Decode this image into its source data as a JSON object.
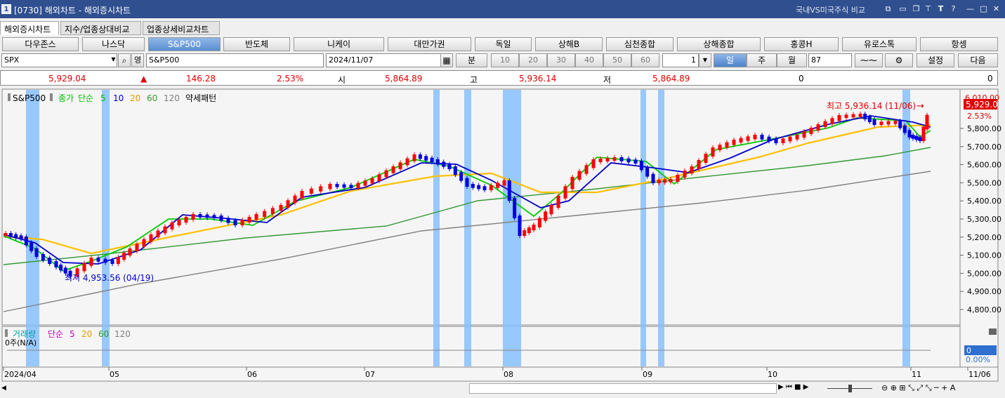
{
  "window": {
    "title": "[0730] 해외차트 - 해외증시차트",
    "badge": "1",
    "compare": "국내VS미국주식 비교",
    "tool_t": "T",
    "tool_q": "?",
    "tool_min": "—",
    "tool_max": "□",
    "tool_close": "✕"
  },
  "tabs": [
    "해외증시차트",
    "지수/업종상대비교",
    "업종상세비교차트"
  ],
  "markets": [
    "다우존스",
    "나스닥",
    "S&P500",
    "반도체",
    "니케이",
    "대만가권",
    "독일",
    "상해B",
    "심천종합",
    "상해종합",
    "홍콩H",
    "유로스톡",
    "항셍"
  ],
  "controls": {
    "symbol": "SPX",
    "kor_btn": "영",
    "name": "S&P500",
    "date": "2024/11/07",
    "minute": "분",
    "intervals": [
      "10",
      "20",
      "30",
      "40",
      "50",
      "60"
    ],
    "unit_count": "1",
    "periods": [
      "일",
      "주",
      "월"
    ],
    "count": "87",
    "settings": "설정",
    "next": "다음"
  },
  "quote": {
    "price": "5,929.04",
    "arrow": "▲",
    "change": "146.28",
    "pct": "2.53%",
    "open_lbl": "시",
    "open": "5,864.89",
    "high_lbl": "고",
    "high": "5,936.14",
    "low_lbl": "저",
    "low": "5,864.89",
    "vol1": "0",
    "vol2": "0"
  },
  "legend": {
    "name": "S&P500",
    "close": "종가",
    "simple": "단순",
    "ma": [
      "5",
      "10",
      "20",
      "60",
      "120"
    ],
    "pattern": "약세패턴"
  },
  "annotations": {
    "max": "최고 5,936.14 (11/06)",
    "min": "최저 4,953.56 (04/19)",
    "last": "5,929.0",
    "pct": "2.53%",
    "axis_top": "6,010.00"
  },
  "y_ticks": [
    "5,800.00",
    "5,700.00",
    "5,600.00",
    "5,500.00",
    "5,400.00",
    "5,300.00",
    "5,200.00",
    "5,100.00",
    "5,000.00",
    "4,900.00",
    "4,800.00"
  ],
  "volume": {
    "title": "거래량",
    "simple": "단순",
    "ma": [
      "5",
      "20",
      "60",
      "120"
    ],
    "value": "0주(N/A)",
    "axis_val": "0",
    "axis_pct": "0.00%"
  },
  "x_labels": [
    "2024/04",
    "05",
    "06",
    "07",
    "08",
    "09",
    "10",
    "11",
    "11/06"
  ],
  "colors": {
    "up": "#ff0000",
    "down": "#0000e0",
    "ma5": "#00cc00",
    "ma10": "#0000cc",
    "ma20": "#ffc000",
    "ma60": "#339933",
    "ma120": "#808080",
    "highlight": "#86c0ff"
  },
  "chart_data": {
    "type": "candlestick",
    "x": [
      "2024/04/01",
      "2024/11/07"
    ],
    "ylim": [
      4750,
      6010
    ],
    "min": {
      "value": 4953.56,
      "date": "04/19"
    },
    "max": {
      "value": 5936.14,
      "date": "11/06"
    },
    "last": 5929.04
  }
}
